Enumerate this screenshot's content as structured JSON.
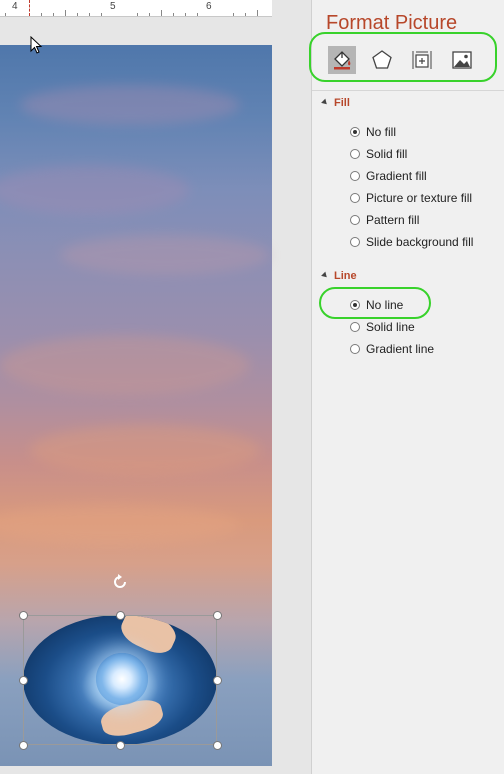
{
  "ruler": {
    "numbers": [
      "4",
      "5",
      "6"
    ]
  },
  "pane": {
    "title": "Format Picture",
    "tabs": [
      {
        "name": "Fill & Line",
        "icon": "paint-bucket-icon"
      },
      {
        "name": "Effects",
        "icon": "pentagon-icon"
      },
      {
        "name": "Size & Properties",
        "icon": "size-properties-icon"
      },
      {
        "name": "Picture",
        "icon": "picture-icon"
      }
    ],
    "fill": {
      "heading": "Fill",
      "options": [
        "No fill",
        "Solid fill",
        "Gradient fill",
        "Picture or texture fill",
        "Pattern fill",
        "Slide background fill"
      ],
      "selected": "No fill"
    },
    "line": {
      "heading": "Line",
      "options": [
        "No line",
        "Solid line",
        "Gradient line"
      ],
      "selected": "No line"
    }
  },
  "colors": {
    "accent": "#b7472a",
    "highlight": "#38d22b",
    "pane_bg": "#f0f0f0"
  }
}
